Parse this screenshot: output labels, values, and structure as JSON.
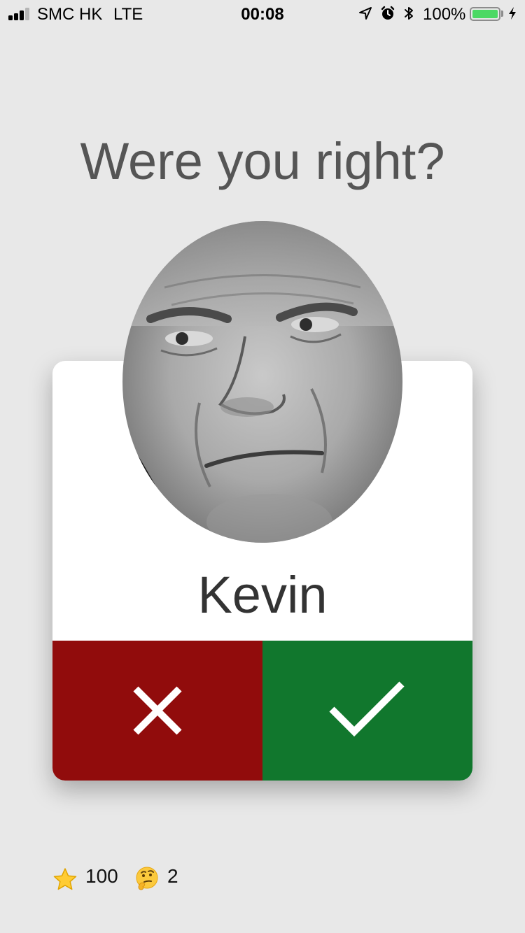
{
  "status_bar": {
    "carrier": "SMC HK",
    "network": "LTE",
    "time": "00:08",
    "battery_percent": "100%",
    "signal_bars_active": 3,
    "signal_bars_total": 4,
    "icons": [
      "location-arrow-icon",
      "alarm-clock-icon",
      "bluetooth-icon",
      "charging-bolt-icon"
    ]
  },
  "question": "Were you right?",
  "card": {
    "person_name": "Kevin",
    "wrong_button_icon": "close-x-icon",
    "right_button_icon": "checkmark-icon",
    "colors": {
      "wrong": "#910c0c",
      "right": "#11772d"
    }
  },
  "footer": {
    "stars_icon": "star-icon",
    "stars_count": "100",
    "thinking_icon": "thinking-face-icon",
    "thinking_count": "2"
  }
}
